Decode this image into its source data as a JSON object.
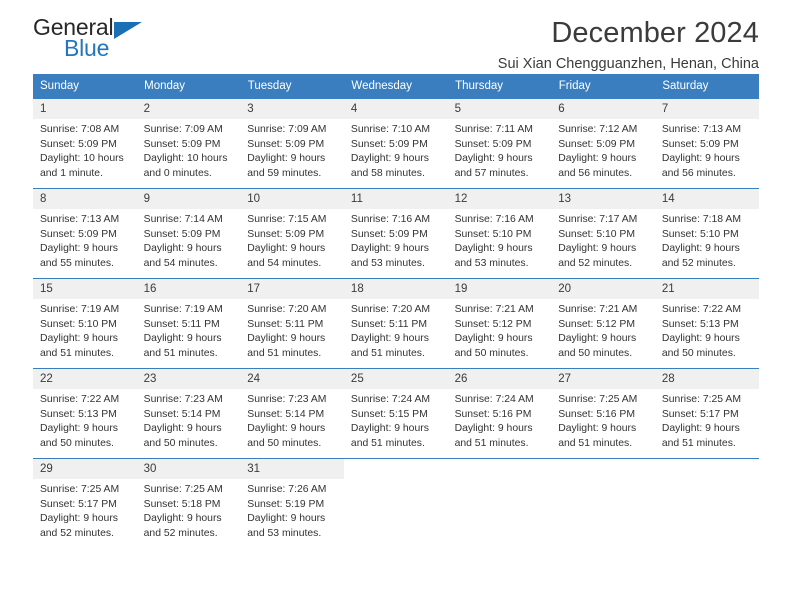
{
  "brand": {
    "name_part1": "General",
    "name_part2": "Blue",
    "accent_color": "#2176bd",
    "triangle_icon": "brand-triangle-icon"
  },
  "header": {
    "title": "December 2024",
    "subtitle": "Sui Xian Chengguanzhen, Henan, China"
  },
  "calendar": {
    "header_bg": "#3a7ebf",
    "daynum_bg": "#f0f0f0",
    "weekday_labels": [
      "Sunday",
      "Monday",
      "Tuesday",
      "Wednesday",
      "Thursday",
      "Friday",
      "Saturday"
    ],
    "weeks": [
      [
        {
          "day": "1",
          "sunrise": "Sunrise: 7:08 AM",
          "sunset": "Sunset: 5:09 PM",
          "daylight1": "Daylight: 10 hours",
          "daylight2": "and 1 minute."
        },
        {
          "day": "2",
          "sunrise": "Sunrise: 7:09 AM",
          "sunset": "Sunset: 5:09 PM",
          "daylight1": "Daylight: 10 hours",
          "daylight2": "and 0 minutes."
        },
        {
          "day": "3",
          "sunrise": "Sunrise: 7:09 AM",
          "sunset": "Sunset: 5:09 PM",
          "daylight1": "Daylight: 9 hours",
          "daylight2": "and 59 minutes."
        },
        {
          "day": "4",
          "sunrise": "Sunrise: 7:10 AM",
          "sunset": "Sunset: 5:09 PM",
          "daylight1": "Daylight: 9 hours",
          "daylight2": "and 58 minutes."
        },
        {
          "day": "5",
          "sunrise": "Sunrise: 7:11 AM",
          "sunset": "Sunset: 5:09 PM",
          "daylight1": "Daylight: 9 hours",
          "daylight2": "and 57 minutes."
        },
        {
          "day": "6",
          "sunrise": "Sunrise: 7:12 AM",
          "sunset": "Sunset: 5:09 PM",
          "daylight1": "Daylight: 9 hours",
          "daylight2": "and 56 minutes."
        },
        {
          "day": "7",
          "sunrise": "Sunrise: 7:13 AM",
          "sunset": "Sunset: 5:09 PM",
          "daylight1": "Daylight: 9 hours",
          "daylight2": "and 56 minutes."
        }
      ],
      [
        {
          "day": "8",
          "sunrise": "Sunrise: 7:13 AM",
          "sunset": "Sunset: 5:09 PM",
          "daylight1": "Daylight: 9 hours",
          "daylight2": "and 55 minutes."
        },
        {
          "day": "9",
          "sunrise": "Sunrise: 7:14 AM",
          "sunset": "Sunset: 5:09 PM",
          "daylight1": "Daylight: 9 hours",
          "daylight2": "and 54 minutes."
        },
        {
          "day": "10",
          "sunrise": "Sunrise: 7:15 AM",
          "sunset": "Sunset: 5:09 PM",
          "daylight1": "Daylight: 9 hours",
          "daylight2": "and 54 minutes."
        },
        {
          "day": "11",
          "sunrise": "Sunrise: 7:16 AM",
          "sunset": "Sunset: 5:09 PM",
          "daylight1": "Daylight: 9 hours",
          "daylight2": "and 53 minutes."
        },
        {
          "day": "12",
          "sunrise": "Sunrise: 7:16 AM",
          "sunset": "Sunset: 5:10 PM",
          "daylight1": "Daylight: 9 hours",
          "daylight2": "and 53 minutes."
        },
        {
          "day": "13",
          "sunrise": "Sunrise: 7:17 AM",
          "sunset": "Sunset: 5:10 PM",
          "daylight1": "Daylight: 9 hours",
          "daylight2": "and 52 minutes."
        },
        {
          "day": "14",
          "sunrise": "Sunrise: 7:18 AM",
          "sunset": "Sunset: 5:10 PM",
          "daylight1": "Daylight: 9 hours",
          "daylight2": "and 52 minutes."
        }
      ],
      [
        {
          "day": "15",
          "sunrise": "Sunrise: 7:19 AM",
          "sunset": "Sunset: 5:10 PM",
          "daylight1": "Daylight: 9 hours",
          "daylight2": "and 51 minutes."
        },
        {
          "day": "16",
          "sunrise": "Sunrise: 7:19 AM",
          "sunset": "Sunset: 5:11 PM",
          "daylight1": "Daylight: 9 hours",
          "daylight2": "and 51 minutes."
        },
        {
          "day": "17",
          "sunrise": "Sunrise: 7:20 AM",
          "sunset": "Sunset: 5:11 PM",
          "daylight1": "Daylight: 9 hours",
          "daylight2": "and 51 minutes."
        },
        {
          "day": "18",
          "sunrise": "Sunrise: 7:20 AM",
          "sunset": "Sunset: 5:11 PM",
          "daylight1": "Daylight: 9 hours",
          "daylight2": "and 51 minutes."
        },
        {
          "day": "19",
          "sunrise": "Sunrise: 7:21 AM",
          "sunset": "Sunset: 5:12 PM",
          "daylight1": "Daylight: 9 hours",
          "daylight2": "and 50 minutes."
        },
        {
          "day": "20",
          "sunrise": "Sunrise: 7:21 AM",
          "sunset": "Sunset: 5:12 PM",
          "daylight1": "Daylight: 9 hours",
          "daylight2": "and 50 minutes."
        },
        {
          "day": "21",
          "sunrise": "Sunrise: 7:22 AM",
          "sunset": "Sunset: 5:13 PM",
          "daylight1": "Daylight: 9 hours",
          "daylight2": "and 50 minutes."
        }
      ],
      [
        {
          "day": "22",
          "sunrise": "Sunrise: 7:22 AM",
          "sunset": "Sunset: 5:13 PM",
          "daylight1": "Daylight: 9 hours",
          "daylight2": "and 50 minutes."
        },
        {
          "day": "23",
          "sunrise": "Sunrise: 7:23 AM",
          "sunset": "Sunset: 5:14 PM",
          "daylight1": "Daylight: 9 hours",
          "daylight2": "and 50 minutes."
        },
        {
          "day": "24",
          "sunrise": "Sunrise: 7:23 AM",
          "sunset": "Sunset: 5:14 PM",
          "daylight1": "Daylight: 9 hours",
          "daylight2": "and 50 minutes."
        },
        {
          "day": "25",
          "sunrise": "Sunrise: 7:24 AM",
          "sunset": "Sunset: 5:15 PM",
          "daylight1": "Daylight: 9 hours",
          "daylight2": "and 51 minutes."
        },
        {
          "day": "26",
          "sunrise": "Sunrise: 7:24 AM",
          "sunset": "Sunset: 5:16 PM",
          "daylight1": "Daylight: 9 hours",
          "daylight2": "and 51 minutes."
        },
        {
          "day": "27",
          "sunrise": "Sunrise: 7:25 AM",
          "sunset": "Sunset: 5:16 PM",
          "daylight1": "Daylight: 9 hours",
          "daylight2": "and 51 minutes."
        },
        {
          "day": "28",
          "sunrise": "Sunrise: 7:25 AM",
          "sunset": "Sunset: 5:17 PM",
          "daylight1": "Daylight: 9 hours",
          "daylight2": "and 51 minutes."
        }
      ],
      [
        {
          "day": "29",
          "sunrise": "Sunrise: 7:25 AM",
          "sunset": "Sunset: 5:17 PM",
          "daylight1": "Daylight: 9 hours",
          "daylight2": "and 52 minutes."
        },
        {
          "day": "30",
          "sunrise": "Sunrise: 7:25 AM",
          "sunset": "Sunset: 5:18 PM",
          "daylight1": "Daylight: 9 hours",
          "daylight2": "and 52 minutes."
        },
        {
          "day": "31",
          "sunrise": "Sunrise: 7:26 AM",
          "sunset": "Sunset: 5:19 PM",
          "daylight1": "Daylight: 9 hours",
          "daylight2": "and 53 minutes."
        },
        {
          "day": "",
          "sunrise": "",
          "sunset": "",
          "daylight1": "",
          "daylight2": ""
        },
        {
          "day": "",
          "sunrise": "",
          "sunset": "",
          "daylight1": "",
          "daylight2": ""
        },
        {
          "day": "",
          "sunrise": "",
          "sunset": "",
          "daylight1": "",
          "daylight2": ""
        },
        {
          "day": "",
          "sunrise": "",
          "sunset": "",
          "daylight1": "",
          "daylight2": ""
        }
      ]
    ]
  }
}
